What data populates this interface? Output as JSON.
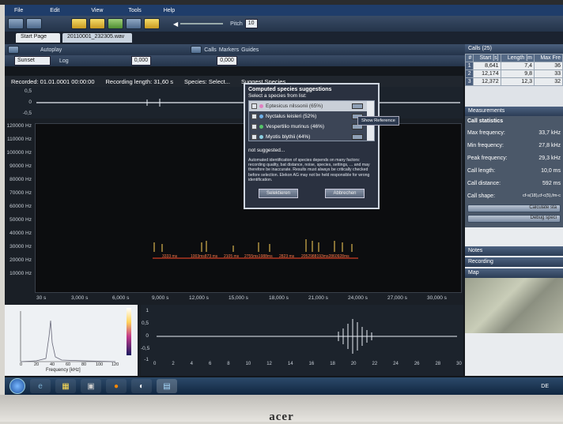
{
  "menu": {
    "items": [
      "File",
      "Edit",
      "View",
      "Tools",
      "Help"
    ]
  },
  "toolbar1": {
    "pitch_label": "Pitch",
    "pitch_value": "10"
  },
  "toolbar2": {
    "tab_start": "Start Page",
    "tab_file": "20110001_232305.wav"
  },
  "toolbar3": {
    "autoplay": "Autoplay",
    "calls": "Calls",
    "markers": "Markers",
    "guides": "Guides"
  },
  "toolbar4": {
    "preset": "Sunset",
    "log": "Log",
    "field1": "0,000",
    "field2": "0,000"
  },
  "info": {
    "recorded": "Recorded: 01.01.0001 00:00:00",
    "length": "Recording length: 31,60 s",
    "species": "Species: Select...",
    "suggest": "Suggest Species..."
  },
  "wave_top_axis": [
    "0,5",
    "0",
    "-0,5"
  ],
  "spec_y_axis": [
    "120000 Hz",
    "110000 Hz",
    "100000 Hz",
    "90000 Hz",
    "80000 Hz",
    "70000 Hz",
    "60000 Hz",
    "50000 Hz",
    "40000 Hz",
    "30000 Hz",
    "20000 Hz",
    "10000 Hz"
  ],
  "spec_x_axis": [
    "30 s",
    "3,000 s",
    "6,000 s",
    "9,000 s",
    "12,000 s",
    "15,000 s",
    "18,000 s",
    "21,000 s",
    "24,000 s",
    "27,000 s",
    "30,000 s"
  ],
  "spec_marks": [
    "3333 ms",
    "1003ms873 ms",
    "2105 ms",
    "2755ms1988ms",
    "2823 ms",
    "2052988193ms2860928ms"
  ],
  "left_panel": {
    "xlabel": "Frequency [kHz]",
    "ticks": [
      "0",
      "20",
      "40",
      "60",
      "80",
      "100",
      "120"
    ]
  },
  "right_panel": {
    "y_ticks": [
      "1",
      "0,5",
      "0",
      "-0,5",
      "-1"
    ],
    "x_ticks": [
      "0",
      "2",
      "4",
      "6",
      "8",
      "10",
      "12",
      "14",
      "16",
      "18",
      "20",
      "22",
      "24",
      "26",
      "28",
      "30"
    ]
  },
  "calls": {
    "header": "Calls (25)",
    "columns": [
      "#",
      "Start [s]",
      "Length [m",
      "Max Fre"
    ],
    "rows": [
      {
        "n": "1",
        "start": "8,641",
        "length": "7,4",
        "max": "36"
      },
      {
        "n": "2",
        "start": "12,174",
        "length": "9,8",
        "max": "33"
      },
      {
        "n": "3",
        "start": "12,372",
        "length": "12,3",
        "max": "32"
      }
    ]
  },
  "measurements": {
    "header": "Measurements",
    "section": "Call statistics",
    "stats": [
      {
        "label": "Max frequency:",
        "value": "33,7 kHz"
      },
      {
        "label": "Min frequency:",
        "value": "27,8 kHz"
      },
      {
        "label": "Peak frequency:",
        "value": "29,3 kHz"
      },
      {
        "label": "Call length:",
        "value": "10,0 ms"
      },
      {
        "label": "Call distance:",
        "value": "592 ms"
      },
      {
        "label": "Call shape:",
        "value": "cf-s(18),cf-c(5),fm-c"
      }
    ],
    "button1": "Calculate sta",
    "button2": "Debug speci"
  },
  "collapsed": {
    "notes": "Notes",
    "recording": "Recording",
    "map": "Map"
  },
  "popup": {
    "title": "Computed species suggestions",
    "subtitle": "Select a species from list:",
    "species": [
      {
        "name": "Eptesicus nilssonii (65%)",
        "selected": true
      },
      {
        "name": "Nyctalus leisleri (52%)",
        "selected": false
      },
      {
        "name": "Vespertilio murinus (46%)",
        "selected": false
      },
      {
        "name": "Myotis blythii (44%)",
        "selected": false
      }
    ],
    "not_suggested": "not suggested...",
    "disclaimer": "Automated identification of species depends on many factors: recording quality, bat distance, noise, species, settings, ... and may therefore be inaccurate. Results must always be critically checked before selection. Elekon AG may not be held responsible for wrong identification.",
    "btn_select": "Selektieren",
    "btn_cancel": "Abbrechen",
    "tooltip": "Show Reference"
  },
  "taskbar": {
    "lang": "DE"
  },
  "brand": "acer"
}
